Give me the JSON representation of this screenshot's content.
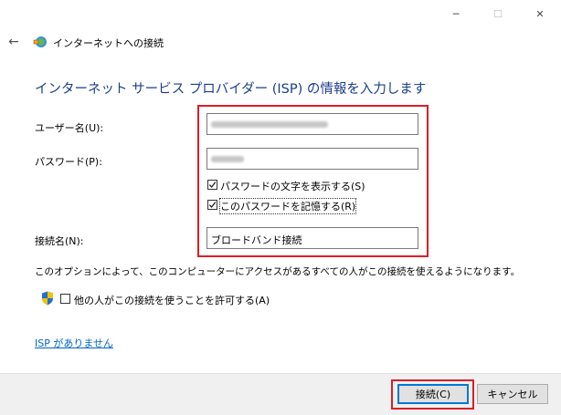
{
  "window": {
    "title": "インターネットへの接続",
    "controls": {
      "minimize_icon": "─",
      "maximize_icon": "☐",
      "close_icon": "✕"
    },
    "back_icon": "←"
  },
  "heading": "インターネット サービス プロバイダー (ISP) の情報を入力します",
  "form": {
    "username_label": "ユーザー名(U):",
    "password_label": "パスワード(P):",
    "show_password_label": "パスワードの文字を表示する(S)",
    "remember_password_label": "このパスワードを記憶する(R)",
    "connection_name_label": "接続名(N):",
    "connection_name_value": "ブロードバンド接続",
    "show_password_checked": true,
    "remember_password_checked": true
  },
  "info_text": "このオプションによって、このコンピューターにアクセスがあるすべての人がこの接続を使えるようになります。",
  "allow_others_label": "他の人がこの接続を使うことを許可する(A)",
  "allow_others_checked": false,
  "no_isp_link": "ISP がありません",
  "buttons": {
    "connect": "接続(C)",
    "cancel": "キャンセル"
  },
  "colors": {
    "highlight": "#d91f26",
    "heading": "#1a3e8c",
    "link": "#0066cc",
    "focus": "#0078d7"
  }
}
